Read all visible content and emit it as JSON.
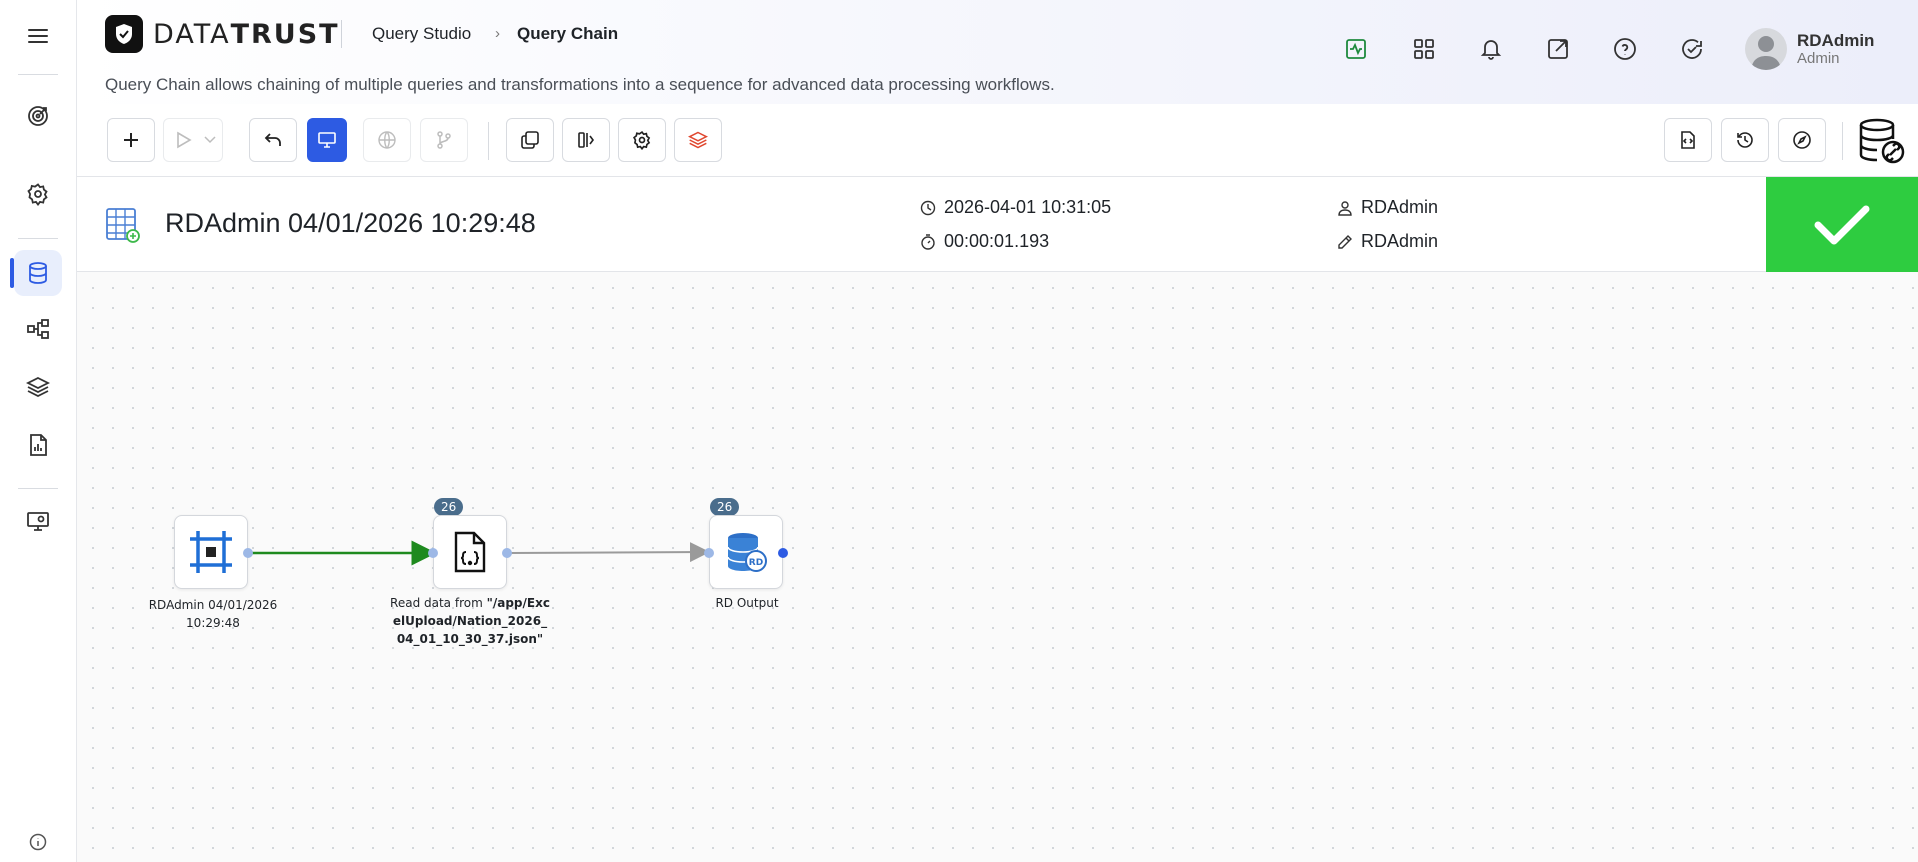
{
  "header": {
    "brand": {
      "light": "DATA",
      "bold": "TRUST"
    },
    "breadcrumb": {
      "parent": "Query Studio",
      "current": "Query Chain"
    },
    "subtitle": "Query Chain allows chaining of multiple queries and transformations into a sequence for advanced data processing workflows.",
    "user": {
      "name": "RDAdmin",
      "role": "Admin"
    }
  },
  "query": {
    "title": "RDAdmin 04/01/2026 10:29:48",
    "run_time": "2026-04-01 10:31:05",
    "duration": "00:00:01.193",
    "owner": "RDAdmin",
    "editor": "RDAdmin"
  },
  "nodes": {
    "source": {
      "label": "RDAdmin 04/01/2026 10:29:48"
    },
    "read": {
      "count": "26",
      "label_prefix": "Read data from ",
      "label_path": "\"/app/ExcelUpload/Nation_2026_04_01_10_30_37.json\""
    },
    "output": {
      "count": "26",
      "label": "RD Output"
    }
  },
  "colors": {
    "accent": "#2d5be3",
    "success": "#2ecc40",
    "edge_active": "#1e8a1e",
    "edge_idle": "#9a9a9a"
  }
}
